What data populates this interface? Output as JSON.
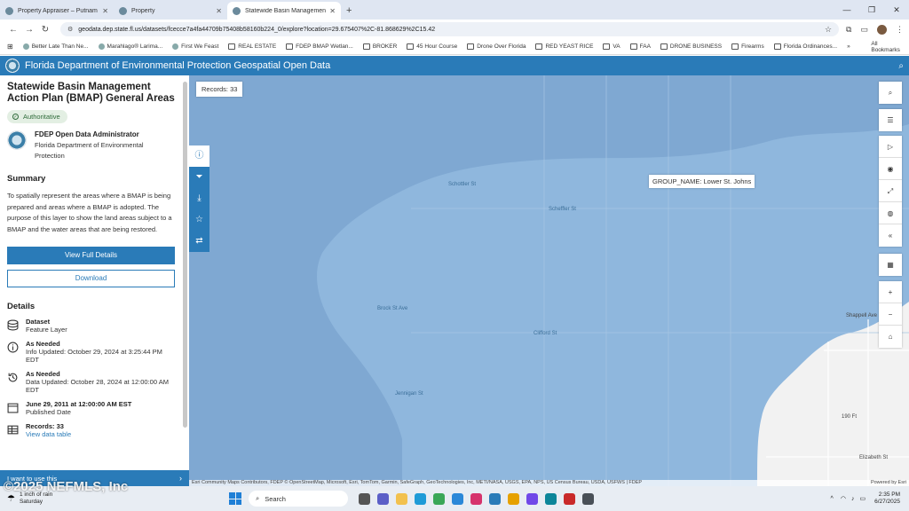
{
  "browser": {
    "tabs": [
      {
        "title": "Property Appraiser – Putnam C",
        "active": false
      },
      {
        "title": "Property",
        "active": false
      },
      {
        "title": "Statewide Basin Management A",
        "active": true
      }
    ],
    "new_tab": "+",
    "url": "geodata.dep.state.fl.us/datasets/fcecce7a4fa44709b75408b58160b224_0/explore?location=29.675407%2C-81.868629%2C15.42",
    "bookmarks": [
      "Better Late Than Ne...",
      "Marahlago® Larima...",
      "First We Feast",
      "REAL ESTATE",
      "FDEP BMAP Wetlan...",
      "BROKER",
      "45 Hour Course",
      "Drone Over Florida",
      "RED YEAST RICE",
      "VA",
      "FAA",
      "DRONE BUSINESS",
      "Firearms",
      "Florida Ordinances..."
    ],
    "all_bookmarks": "All Bookmarks"
  },
  "app": {
    "title": "Florida Department of Environmental Protection Geospatial Open Data"
  },
  "panel": {
    "title": "Statewide Basin Management Action Plan (BMAP) General Areas",
    "badge": "Authoritative",
    "owner_name": "FDEP Open Data Administrator",
    "owner_org": "Florida Department of Environmental Protection",
    "summary_heading": "Summary",
    "summary": "To spatially represent the areas where a BMAP is being prepared and areas where a BMAP is adopted. The purpose of this layer to show the land areas subject to a BMAP and the water areas that are being restored.",
    "view_full_details": "View Full Details",
    "download": "Download",
    "details_heading": "Details",
    "details": [
      {
        "key": "Dataset",
        "value": "Feature Layer"
      },
      {
        "key": "As Needed",
        "value": "Info Updated: October 29, 2024 at 3:25:44 PM EDT"
      },
      {
        "key": "As Needed",
        "value": "Data Updated: October 28, 2024 at 12:00:00 AM EDT"
      },
      {
        "key": "June 29, 2011 at 12:00:00 AM EST",
        "value": "Published Date"
      },
      {
        "key": "Records: 33",
        "value": "View data table"
      }
    ],
    "i_want": "I want to use this"
  },
  "map": {
    "records": "Records: 33",
    "tooltip": "GROUP_NAME: Lower St. Johns",
    "street_labels": [
      "Scheffler St",
      "Clifford St",
      "Jennigan St",
      "Schottler St",
      "Elizabeth St",
      "Shappell Ave",
      "190 Ft",
      "Brock St Ave"
    ],
    "attribution": "Esri Community Maps Contributors, FDEP © OpenStreetMap, Microsoft, Esri, TomTom, Garmin, SafeGraph, GeoTechnologies, Inc, METI/NASA, USGS, EPA, NPS, US Census Bureau, USDA, USFWS | FDEP",
    "powered_by": "Powered by Esri"
  },
  "taskbar": {
    "weather_line1": "1 inch of rain",
    "weather_line2": "Saturday",
    "search_placeholder": "Search",
    "time": "2:35 PM",
    "date": "6/27/2025"
  },
  "watermark": "©2025 NEFMLS, Inc",
  "colors": {
    "accent": "#2a7bb8",
    "map_water": "#8fb7dd",
    "map_dark": "#7fa8d2"
  }
}
